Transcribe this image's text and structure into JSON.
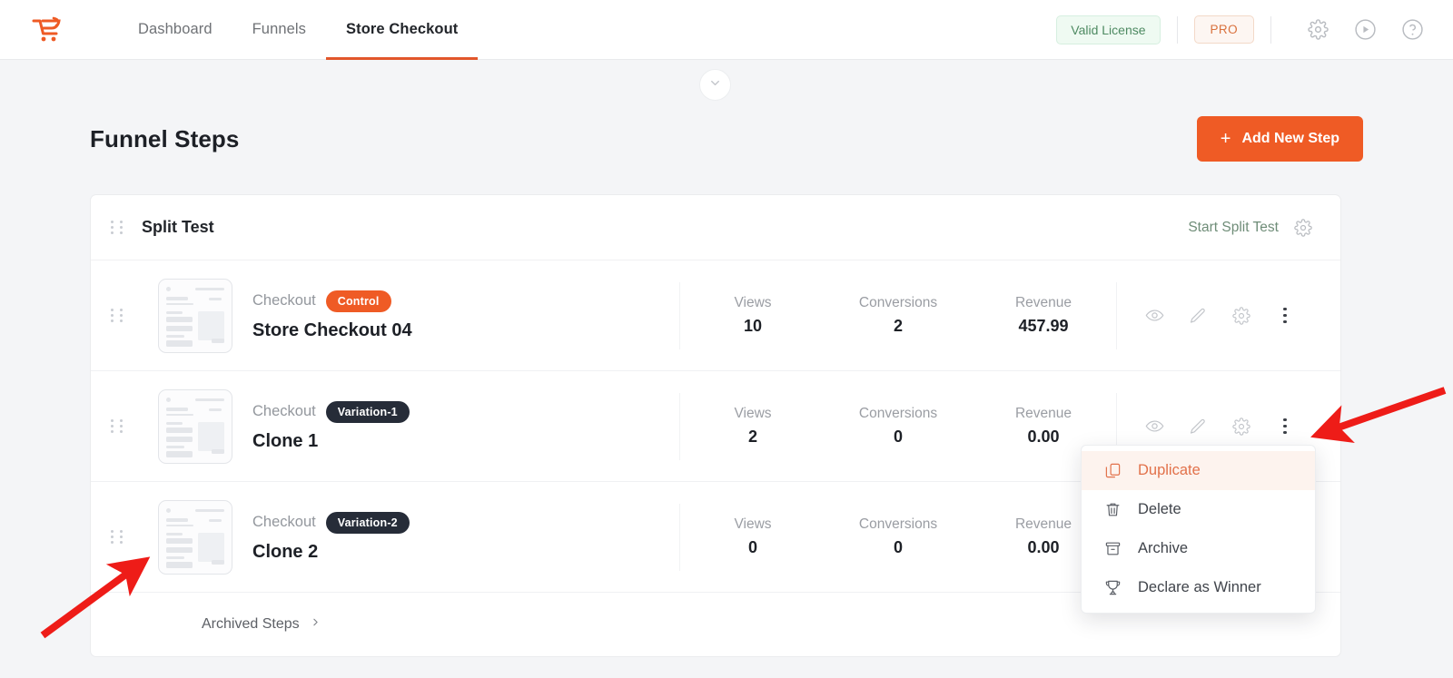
{
  "header": {
    "logo_icon": "cartflows-logo-icon",
    "nav": [
      {
        "label": "Dashboard",
        "active": false
      },
      {
        "label": "Funnels",
        "active": false
      },
      {
        "label": "Store Checkout",
        "active": true
      }
    ],
    "license_badge": "Valid License",
    "pro_badge": "PRO",
    "icons": [
      {
        "name": "gear-icon"
      },
      {
        "name": "play-circle-icon"
      },
      {
        "name": "help-circle-icon"
      }
    ]
  },
  "collapse": {
    "icon": "chevron-down-icon"
  },
  "page": {
    "title": "Funnel Steps",
    "add_button": {
      "label": "Add New Step",
      "icon": "plus-icon",
      "color": "#ef5b25"
    }
  },
  "split_test": {
    "title": "Split Test",
    "drag_handle": "drag-handle-icon",
    "start_label": "Start Split Test",
    "start_color": "#6f8d78",
    "settings_icon": "gear-icon"
  },
  "columns": {
    "views": "Views",
    "conversions": "Conversions",
    "revenue": "Revenue"
  },
  "rows": [
    {
      "type": "Checkout",
      "badge": "Control",
      "badge_style": "control",
      "badge_color": "#ef5b25",
      "name": "Store Checkout 04",
      "views": "10",
      "conversions": "2",
      "revenue": "457.99"
    },
    {
      "type": "Checkout",
      "badge": "Variation-1",
      "badge_style": "variation",
      "badge_color": "#262c38",
      "name": "Clone 1",
      "views": "2",
      "conversions": "0",
      "revenue": "0.00"
    },
    {
      "type": "Checkout",
      "badge": "Variation-2",
      "badge_style": "variation",
      "badge_color": "#262c38",
      "name": "Clone 2",
      "views": "0",
      "conversions": "0",
      "revenue": "0.00"
    }
  ],
  "row_actions": [
    {
      "name": "preview-icon"
    },
    {
      "name": "edit-pencil-icon"
    },
    {
      "name": "gear-icon"
    },
    {
      "name": "more-vertical-icon"
    }
  ],
  "archived": {
    "label": "Archived Steps",
    "icon": "chevron-right-icon"
  },
  "context_menu": {
    "items": [
      {
        "label": "Duplicate",
        "icon": "copy-icon",
        "highlighted": true
      },
      {
        "label": "Delete",
        "icon": "trash-icon",
        "highlighted": false
      },
      {
        "label": "Archive",
        "icon": "archive-box-icon",
        "highlighted": false
      },
      {
        "label": "Declare as Winner",
        "icon": "trophy-icon",
        "highlighted": false
      }
    ],
    "highlight_color": "#e2714a"
  },
  "annotations": {
    "arrow_color": "#ee1c18",
    "arrows": [
      {
        "name": "arrow-to-kebab-menu"
      },
      {
        "name": "arrow-to-clone2-thumbnail"
      }
    ]
  }
}
